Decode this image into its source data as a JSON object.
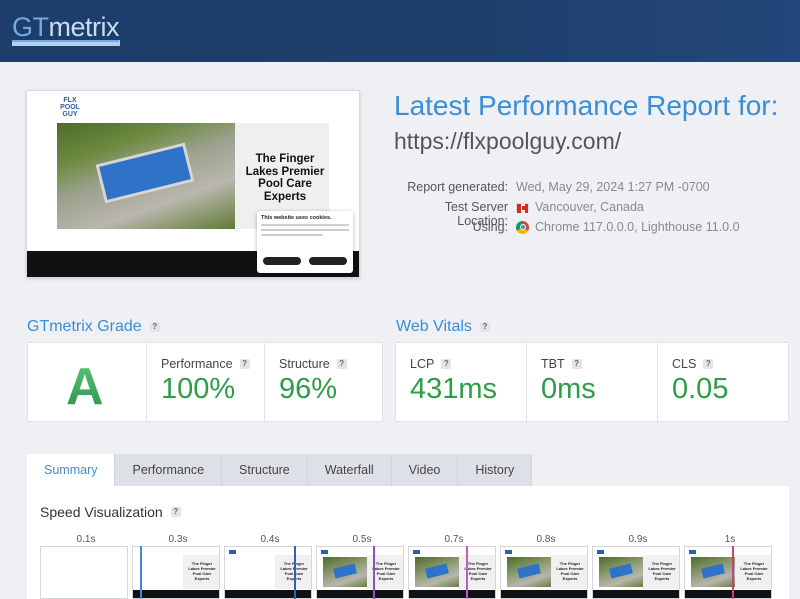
{
  "header": {
    "logo_gt": "GT",
    "logo_metrix": "metrix"
  },
  "thumbnail": {
    "site_logo": "FLX POOL GUY",
    "headline": "The Finger Lakes Premier Pool Care Experts",
    "cookie_title": "This website uses cookies."
  },
  "report": {
    "title": "Latest Performance Report for:",
    "url": "https://flxpoolguy.com/",
    "generated_label": "Report generated:",
    "generated_value": "Wed, May 29, 2024 1:27 PM -0700",
    "server_label": "Test Server Location:",
    "server_value": "Vancouver, Canada",
    "using_label": "Using:",
    "using_value": "Chrome 117.0.0.0, Lighthouse 11.0.0"
  },
  "grade": {
    "title": "GTmetrix Grade",
    "letter": "A",
    "performance_label": "Performance",
    "performance_value": "100%",
    "structure_label": "Structure",
    "structure_value": "96%"
  },
  "vitals": {
    "title": "Web Vitals",
    "lcp_label": "LCP",
    "lcp_value": "431ms",
    "tbt_label": "TBT",
    "tbt_value": "0ms",
    "cls_label": "CLS",
    "cls_value": "0.05"
  },
  "tabs": [
    "Summary",
    "Performance",
    "Structure",
    "Waterfall",
    "Video",
    "History"
  ],
  "speed_visualization": {
    "title": "Speed Visualization",
    "times": [
      "0.1s",
      "0.3s",
      "0.4s",
      "0.5s",
      "0.7s",
      "0.8s",
      "0.9s",
      "1s"
    ],
    "frame_text": "The Finger Lakes Premier Pool Care Experts"
  },
  "help_glyph": "?",
  "colors": {
    "accent": "#3a8ed6",
    "good": "#2e9d46",
    "header": "#1d3e6a"
  }
}
